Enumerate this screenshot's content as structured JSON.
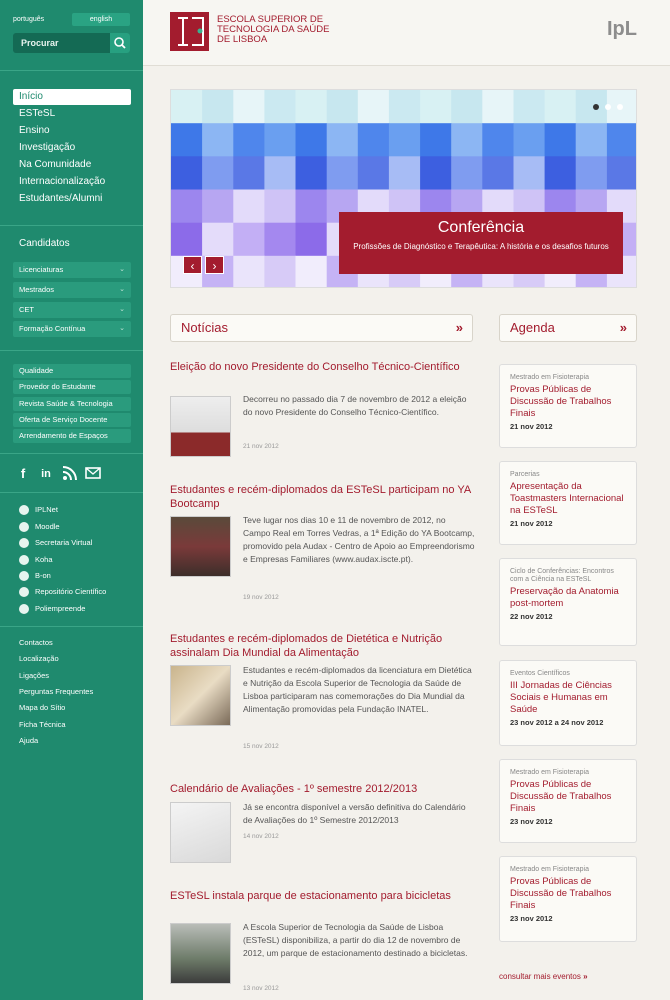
{
  "lang": {
    "pt": "português",
    "en": "english"
  },
  "search": {
    "placeholder": "Procurar"
  },
  "nav": [
    "Início",
    "ESTeSL",
    "Ensino",
    "Investigação",
    "Na Comunidade",
    "Internacionalização",
    "Estudantes/Alumni"
  ],
  "candidatos": {
    "title": "Candidatos",
    "items": [
      "Licenciaturas",
      "Mestrados",
      "CET",
      "Formação Contínua"
    ]
  },
  "links": [
    "Qualidade",
    "Provedor do Estudante",
    "Revista Saúde & Tecnologia",
    "Oferta de Serviço Docente",
    "Arrendamento de Espaços"
  ],
  "external": [
    "IPLNet",
    "Moodle",
    "Secretaria Virtual",
    "Koha",
    "B-on",
    "Repositório Científico",
    "Poliempreende"
  ],
  "footer_links": [
    "Contactos",
    "Localização",
    "Ligações",
    "Perguntas Frequentes",
    "Mapa do Sítio",
    "Ficha Técnica",
    "Ajuda"
  ],
  "header": {
    "logo_line1": "ESCOLA SUPERIOR DE",
    "logo_line2": "TECNOLOGIA DA SAÚDE",
    "logo_line3": "DE LISBOA",
    "ipl": "IpL"
  },
  "slider": {
    "title": "Conferência",
    "subtitle": "Profissões de Diagnóstico e Terapêutica: A história e os desafios futuros"
  },
  "news": {
    "title": "Notícias",
    "items": [
      {
        "title": "Eleição do novo Presidente do Conselho Técnico-Científico",
        "text": "Decorreu no passado dia 7 de novembro de 2012 a eleição do novo Presidente do Conselho Técnico-Científico.",
        "date": "21 nov 2012"
      },
      {
        "title": "Estudantes e recém-diplomados da ESTeSL participam no YA Bootcamp",
        "text": "Teve lugar nos dias 10 e 11 de novembro de 2012, no Campo Real em Torres Vedras, a 1ª Edição do YA Bootcamp, promovido pela Audax - Centro de Apoio ao Empreendorismo e Empresas Familiares (www.audax.iscte.pt).",
        "date": "19 nov 2012"
      },
      {
        "title": "Estudantes e recém-diplomados de Dietética e Nutrição assinalam Dia Mundial da Alimentação",
        "text": "Estudantes e recém-diplomados da licenciatura em Dietética e Nutrição da Escola Superior de Tecnologia da Saúde de Lisboa participaram nas comemorações do Dia Mundial da Alimentação promovidas pela Fundação INATEL.",
        "date": "15 nov 2012"
      },
      {
        "title": "Calendário de Avaliações - 1º semestre 2012/2013",
        "text": "Já se encontra disponível a versão definitiva do Calendário de Avaliações do 1º Semestre 2012/2013",
        "date": "14 nov 2012"
      },
      {
        "title": "ESTeSL instala parque de estacionamento para bicicletas",
        "text": "A Escola Superior de Tecnologia da Saúde de Lisboa (ESTeSL) disponibiliza, a partir do dia 12 de novembro de 2012, um parque de estacionamento destinado a bicicletas.",
        "date": "13 nov 2012"
      }
    ]
  },
  "agenda": {
    "title": "Agenda",
    "items": [
      {
        "cat": "Mestrado em Fisioterapia",
        "title": "Provas Públicas de Discussão de Trabalhos Finais",
        "date": "21 nov 2012"
      },
      {
        "cat": "Parcerias",
        "title": "Apresentação da Toastmasters Internacional na ESTeSL",
        "date": "21 nov 2012"
      },
      {
        "cat": "Ciclo de Conferências: Encontros com a Ciência na ESTeSL",
        "title": "Preservação da Anatomia post-mortem",
        "date": "22 nov 2012"
      },
      {
        "cat": "Eventos Científicos",
        "title": "III Jornadas de Ciências Sociais e Humanas em Saúde",
        "date": "23 nov 2012 a 24 nov 2012"
      },
      {
        "cat": "Mestrado em Fisioterapia",
        "title": "Provas Públicas de Discussão de Trabalhos Finais",
        "date": "23 nov 2012"
      },
      {
        "cat": "Mestrado em Fisioterapia",
        "title": "Provas Públicas de Discussão de Trabalhos Finais",
        "date": "23 nov 2012"
      }
    ],
    "more": "consultar mais eventos"
  }
}
